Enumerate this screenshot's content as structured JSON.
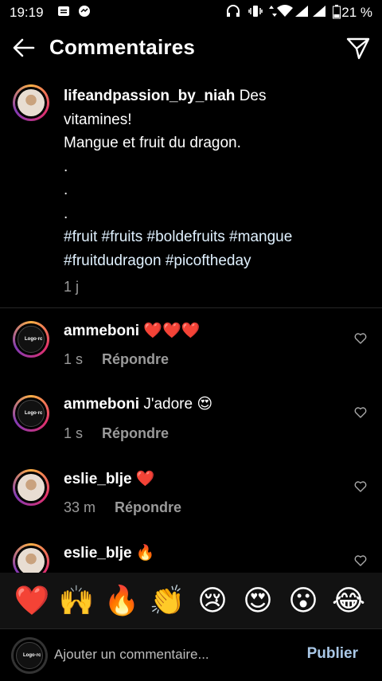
{
  "status": {
    "time": "19:19",
    "battery_percent": "21 %",
    "network": "3G"
  },
  "header": {
    "title": "Commentaires"
  },
  "caption": {
    "username": "lifeandpassion_by_niah",
    "line1": "Des",
    "line2": "vitamines!",
    "line3": "Mangue et fruit du dragon.",
    "dot": ".",
    "hashtags_line1": "#fruit #fruits #boldefruits #mangue",
    "hashtags_line2": "#fruitdudragon #picoftheday",
    "time": "1 j"
  },
  "comments": [
    {
      "username": "ammeboni",
      "text": "❤️❤️❤️",
      "time": "1 s",
      "reply_label": "Répondre"
    },
    {
      "username": "ammeboni",
      "text": "J'adore 😍",
      "time": "1 s",
      "reply_label": "Répondre"
    },
    {
      "username": "eslie_blje",
      "text": "❤️",
      "time": "33 m",
      "reply_label": "Répondre"
    },
    {
      "username": "eslie_blje",
      "text": "🔥",
      "time": "",
      "reply_label": ""
    }
  ],
  "emoji_bar": [
    "❤️",
    "🙌",
    "🔥",
    "👏",
    "😢",
    "😍",
    "😮",
    "😂"
  ],
  "composer": {
    "placeholder": "Ajouter un commentaire...",
    "publish_label": "Publier"
  },
  "avatar_logo_text": "Logo·rc",
  "colors": {
    "background": "#000000",
    "secondary_text": "#9a9a9a",
    "publish": "#a9c7e6",
    "story_ring": "#e1306c"
  }
}
